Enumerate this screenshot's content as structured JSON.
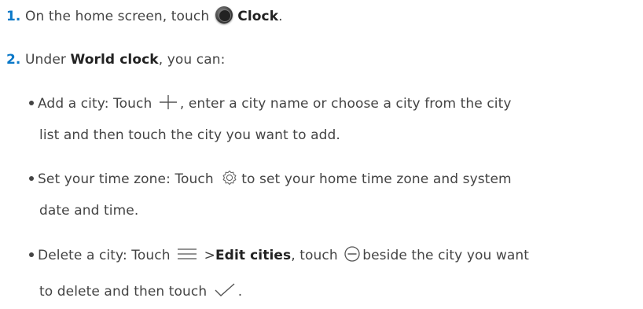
{
  "steps": [
    {
      "number": "1.",
      "text_before": "On the home screen, touch",
      "app_name": "Clock",
      "text_after": "."
    },
    {
      "number": "2.",
      "text_before": "Under",
      "section": "World clock",
      "text_after": ", you can:"
    }
  ],
  "bullets": {
    "add": {
      "line1_before": "Add a city: Touch",
      "line1_after": ", enter a city name or choose a city from the city",
      "line2": "list and then touch the city you want to add."
    },
    "timezone": {
      "line1_before": "Set your time zone: Touch",
      "line1_after": "to set your home time zone and system",
      "line2": "date and time."
    },
    "delete": {
      "line1_before": "Delete a city: Touch",
      "line1_mid": ">",
      "menu_item": "Edit cities",
      "line1_mid2": ", touch",
      "line1_after": "beside the city you want",
      "line2": "to delete and then touch",
      "line2_end": "."
    }
  },
  "icons": {
    "clock_app": "clock-app-icon",
    "add": "plus-icon",
    "settings": "gear-icon",
    "menu": "menu-icon",
    "remove": "minus-circle-icon",
    "confirm": "checkmark-icon"
  }
}
